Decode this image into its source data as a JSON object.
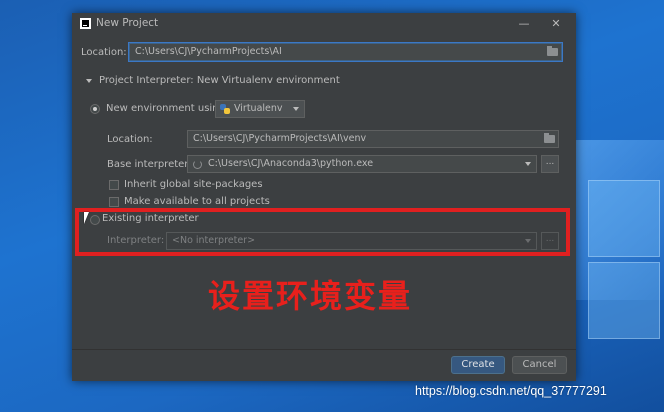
{
  "window": {
    "title": "New Project"
  },
  "location": {
    "label": "Location:",
    "value": "C:\\Users\\CJ\\PycharmProjects\\AI"
  },
  "interpreter_section": {
    "title": "Project Interpreter: New Virtualenv environment"
  },
  "new_env": {
    "radio_label": "New environment using",
    "tool": "Virtualenv",
    "location_label": "Location:",
    "location_value": "C:\\Users\\CJ\\PycharmProjects\\AI\\venv",
    "base_label": "Base interpreter:",
    "base_value": "C:\\Users\\CJ\\Anaconda3\\python.exe",
    "inherit_label": "Inherit global site-packages",
    "available_label": "Make available to all projects"
  },
  "existing": {
    "radio_label": "Existing interpreter",
    "interp_label": "Interpreter:",
    "interp_value": "<No interpreter>"
  },
  "dots": "...",
  "annotation": "设置环境变量",
  "buttons": {
    "create": "Create",
    "cancel": "Cancel"
  },
  "watermark": "https://blog.csdn.net/qq_37777291",
  "colors": {
    "accent": "#365880",
    "highlight": "#e02020",
    "annotation": "#e8201c"
  }
}
